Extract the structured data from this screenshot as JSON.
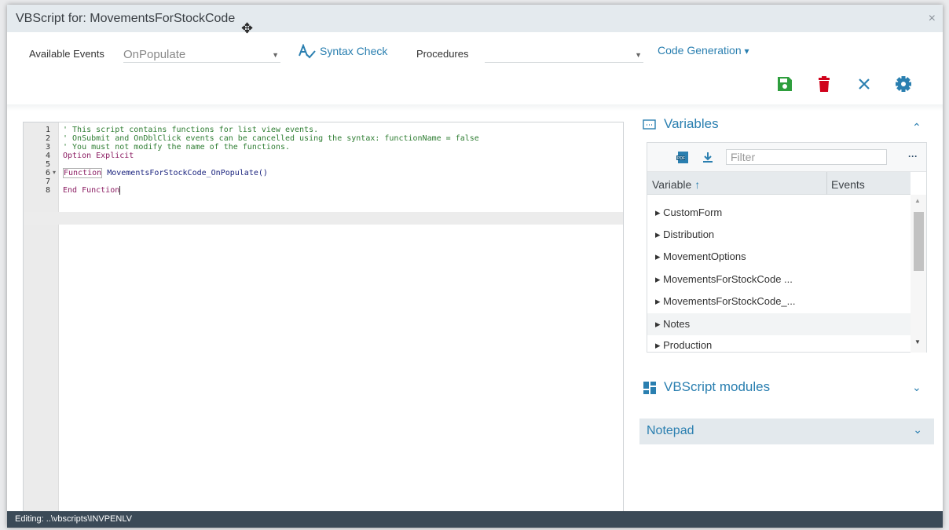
{
  "window": {
    "title": "VBScript for: MovementsForStockCode",
    "close_label": "×"
  },
  "toolbar": {
    "available_events_label": "Available Events",
    "available_events_value": "OnPopulate",
    "syntax_check_label": "Syntax Check",
    "procedures_label": "Procedures",
    "procedures_value": "",
    "code_generation_label": "Code Generation",
    "dropdown_arrow": "▼",
    "caret": "▾"
  },
  "actions": {
    "save_icon": "save-icon",
    "delete_icon": "trash-icon",
    "cancel_icon": "close-icon",
    "settings_icon": "gear-icon",
    "colors": {
      "save": "#2e9e3d",
      "delete": "#d0021b",
      "cancel": "#2a7fb0",
      "settings": "#2a7fb0"
    }
  },
  "editor": {
    "lines": [
      {
        "num": "1",
        "text": "' This script contains functions for list view events."
      },
      {
        "num": "2",
        "text": "' OnSubmit and OnDblClick events can be cancelled using the syntax: functionName = false"
      },
      {
        "num": "3",
        "text": "' You must not modify the name of the functions."
      },
      {
        "num": "4",
        "text": "Option Explicit"
      },
      {
        "num": "5",
        "text": ""
      },
      {
        "num": "6",
        "text": ""
      },
      {
        "num": "7",
        "text": ""
      },
      {
        "num": "8",
        "text": ""
      }
    ],
    "fold_marker": "▾",
    "line6_keyword": "Function",
    "line6_name": "MovementsForStockCode_OnPopulate()",
    "line8_keyword": "End Function"
  },
  "variables_panel": {
    "title": "Variables",
    "collapse_chevron": "⌃",
    "filter_placeholder": "Filter",
    "more_label": "···",
    "col_variable": "Variable",
    "sort_arrow": "↑",
    "col_events": "Events",
    "rows": [
      "▸ CustomForm",
      "▸ Distribution",
      "▸ MovementOptions",
      "▸ MovementsForStockCode ...",
      "▸ MovementsForStockCode_...",
      "▸ Notes",
      "▸ Production"
    ]
  },
  "modules_panel": {
    "title": "VBScript modules",
    "chevron": "⌄"
  },
  "notepad_panel": {
    "title": "Notepad",
    "chevron": "⌄"
  },
  "status": {
    "text": "Editing: ..\\vbscripts\\INVPENLV"
  },
  "accent_color": "#2a7fb0"
}
